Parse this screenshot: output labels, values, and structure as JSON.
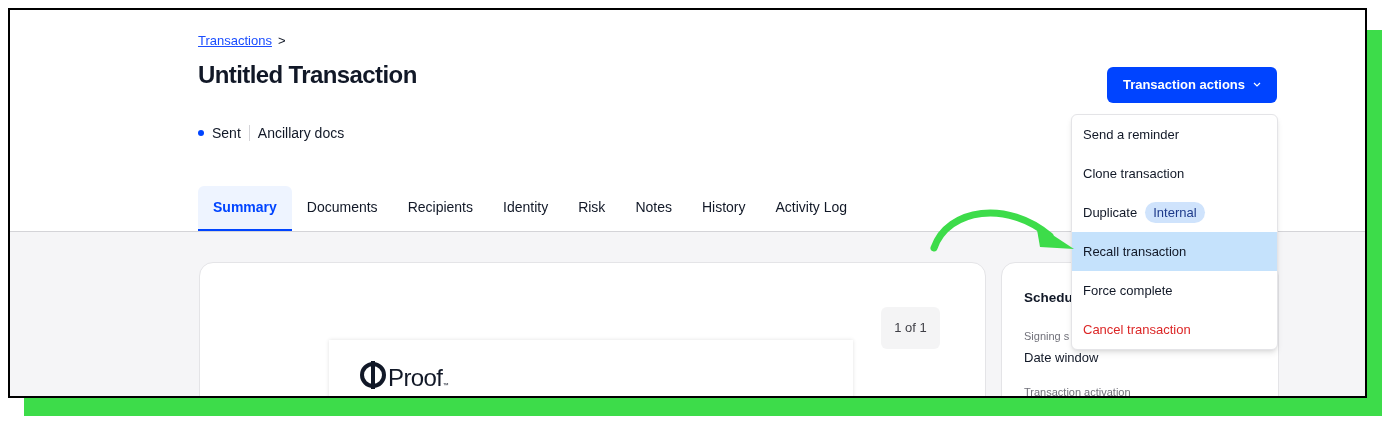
{
  "breadcrumb": {
    "link": "Transactions",
    "separator": ">"
  },
  "title": "Untitled Transaction",
  "status": {
    "label": "Sent",
    "tag": "Ancillary docs"
  },
  "tabs": [
    {
      "label": "Summary",
      "selected": true
    },
    {
      "label": "Documents",
      "selected": false
    },
    {
      "label": "Recipients",
      "selected": false
    },
    {
      "label": "Identity",
      "selected": false
    },
    {
      "label": "Risk",
      "selected": false
    },
    {
      "label": "Notes",
      "selected": false
    },
    {
      "label": "History",
      "selected": false
    },
    {
      "label": "Activity Log",
      "selected": false
    }
  ],
  "actions_button": {
    "label": "Transaction actions",
    "expanded": true
  },
  "menu": [
    {
      "label": "Send a reminder",
      "kind": "normal",
      "selected": false
    },
    {
      "label": "Clone transaction",
      "kind": "normal",
      "selected": false
    },
    {
      "label": "Duplicate",
      "kind": "normal",
      "selected": false,
      "badge": "Internal"
    },
    {
      "label": "Recall transaction",
      "kind": "normal",
      "selected": true
    },
    {
      "label": "Force complete",
      "kind": "normal",
      "selected": false
    },
    {
      "label": "Cancel transaction",
      "kind": "danger",
      "selected": false
    }
  ],
  "document": {
    "page_indicator": "1 of 1",
    "logo": "Proof",
    "logo_mark": "™"
  },
  "schedule_card": {
    "title": "Schedu",
    "fields": [
      {
        "label": "Signing s",
        "value": "Date window"
      },
      {
        "label": "Transaction activation"
      }
    ]
  }
}
